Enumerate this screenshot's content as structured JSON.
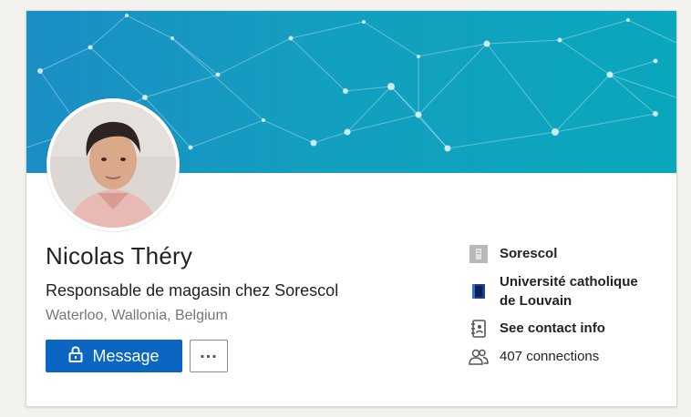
{
  "profile": {
    "name": "Nicolas Théry",
    "headline": "Responsable de magasin chez Sorescol",
    "location": "Waterloo, Wallonia, Belgium"
  },
  "actions": {
    "message_label": "Message",
    "more_label": "..."
  },
  "sidebar": {
    "company": "Sorescol",
    "school_line1": "Université catholique",
    "school_line2": "de Louvain",
    "contact": "See contact info",
    "connections": "407 connections"
  },
  "colors": {
    "accent": "#0a66c2",
    "banner": "#139fc0"
  },
  "icons": {
    "message": "lock-icon",
    "company": "company-icon",
    "school": "school-icon",
    "contact": "contact-card-icon",
    "connections": "people-icon"
  }
}
